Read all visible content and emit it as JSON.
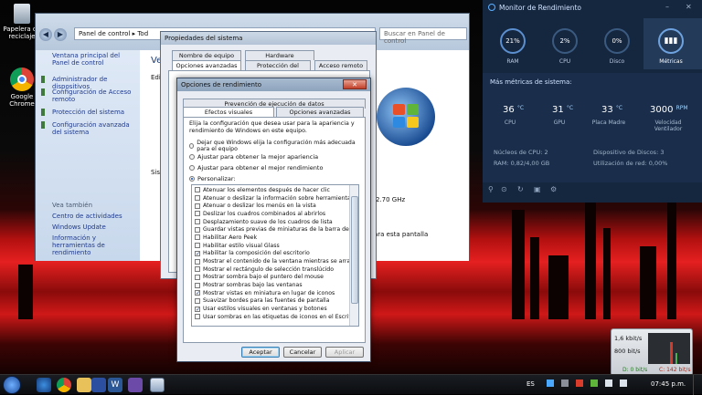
{
  "desktop": {
    "icons": [
      {
        "label": "Papelera de reciclaje"
      },
      {
        "label": "Google Chrome"
      }
    ]
  },
  "explorer": {
    "address": "Panel de control",
    "address_suffix": "Tod",
    "search_placeholder": "Buscar en Panel de control",
    "main_title_partial": "Ve",
    "main_partial_1": "Edi",
    "main_partial_2": "Sist",
    "sidebar_home": "Ventana principal del Panel de control",
    "sidebar_links": [
      "Administrador de dispositivos",
      "Configuración de Acceso remoto",
      "Protección del sistema",
      "Configuración avanzada del sistema"
    ],
    "see_also_title": "Vea también",
    "see_also": [
      "Centro de actividades",
      "Windows Update",
      "Información y herramientas de rendimiento"
    ],
    "clock_speed": "2.70 GHz",
    "pen_text": "ara esta pantalla"
  },
  "sysprops": {
    "title": "Propiedades del sistema",
    "tabs_top": [
      "Nombre de equipo",
      "Hardware"
    ],
    "tabs_bottom": [
      "Opciones avanzadas",
      "Protección del sistema",
      "Acceso remoto"
    ]
  },
  "perf": {
    "title": "Opciones de rendimiento",
    "tab_top": "Prevención de ejecución de datos",
    "tabs": [
      "Efectos visuales",
      "Opciones avanzadas"
    ],
    "description": "Elija la configuración que desea usar para la apariencia y rendimiento de Windows en este equipo.",
    "radios": [
      {
        "label": "Dejar que Windows elija la configuración más adecuada para el equipo",
        "checked": false
      },
      {
        "label": "Ajustar para obtener la mejor apariencia",
        "checked": false
      },
      {
        "label": "Ajustar para obtener el mejor rendimiento",
        "checked": false
      },
      {
        "label": "Personalizar:",
        "checked": true
      }
    ],
    "effects": [
      {
        "label": "Atenuar los elementos después de hacer clic",
        "checked": false
      },
      {
        "label": "Atenuar o deslizar la información sobre herramientas en la",
        "checked": false
      },
      {
        "label": "Atenuar o deslizar los menús en la vista",
        "checked": false
      },
      {
        "label": "Deslizar los cuadros combinados al abrirlos",
        "checked": false
      },
      {
        "label": "Desplazamiento suave de los cuadros de lista",
        "checked": false
      },
      {
        "label": "Guardar vistas previas de miniaturas de la barra de tareas",
        "checked": false
      },
      {
        "label": "Habilitar Aero Peek",
        "checked": false
      },
      {
        "label": "Habilitar estilo visual Glass",
        "checked": false
      },
      {
        "label": "Habilitar la composición del escritorio",
        "checked": true
      },
      {
        "label": "Mostrar el contenido de la ventana mientras se arrastra",
        "checked": false
      },
      {
        "label": "Mostrar el rectángulo de selección translúcido",
        "checked": false
      },
      {
        "label": "Mostrar sombra bajo el puntero del mouse",
        "checked": false
      },
      {
        "label": "Mostrar sombras bajo las ventanas",
        "checked": false
      },
      {
        "label": "Mostrar vistas en miniatura en lugar de iconos",
        "checked": true
      },
      {
        "label": "Suavizar bordes para las fuentes de pantalla",
        "checked": false
      },
      {
        "label": "Usar estilos visuales en ventanas y botones",
        "checked": true
      },
      {
        "label": "Usar sombras en las etiquetas de iconos en el Escritorio",
        "checked": false
      }
    ],
    "buttons": {
      "ok": "Aceptar",
      "cancel": "Cancelar",
      "apply": "Aplicar"
    }
  },
  "monitor": {
    "title": "Monitor de Rendimiento",
    "gauges": [
      {
        "value": "21%",
        "label": "RAM"
      },
      {
        "value": "2%",
        "label": "CPU"
      },
      {
        "value": "0%",
        "label": "Disco"
      },
      {
        "value": "",
        "label": "Métricas"
      }
    ],
    "section_title": "Más métricas de sistema:",
    "temps": [
      {
        "value": "36",
        "unit": "°C",
        "label": "CPU"
      },
      {
        "value": "31",
        "unit": "°C",
        "label": "GPU"
      },
      {
        "value": "33",
        "unit": "°C",
        "label": "Placa Madre"
      },
      {
        "value": "3000",
        "unit": "RPM",
        "label": "Velocidad Ventilador"
      }
    ],
    "cpu_cores": "Núcleos de CPU: 2",
    "disks": "Dispositivo de Discos: 3",
    "ram": "RAM: 0,82/4,00 GB",
    "net_usage": "Utilización de red: 0,00%"
  },
  "netmeter": {
    "top": "1,6 kbit/s",
    "mid": "800 bit/s",
    "down": "D: 0 bit/s",
    "up": "C: 142 bit/s"
  },
  "taskbar": {
    "lang": "ES",
    "time": "07:45 p.m."
  }
}
